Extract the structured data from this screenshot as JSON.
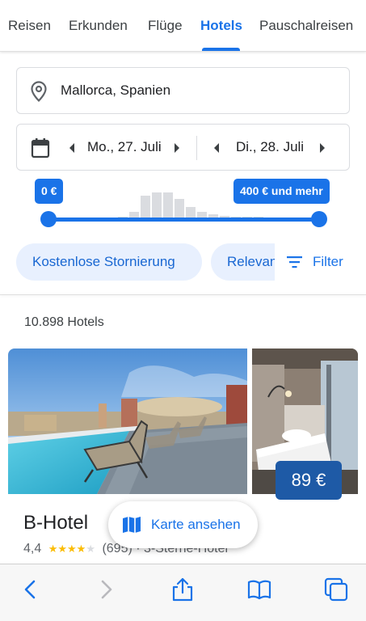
{
  "tabs": [
    {
      "label": "Reisen",
      "active": false
    },
    {
      "label": "Erkunden",
      "active": false
    },
    {
      "label": "Flüge",
      "active": false
    },
    {
      "label": "Hotels",
      "active": true
    },
    {
      "label": "Pauschalreisen",
      "active": false
    }
  ],
  "search": {
    "location_value": "Mallorca, Spanien",
    "location_icon": "location-pin-icon"
  },
  "dates": {
    "checkin": "Mo., 27. Juli",
    "checkout": "Di., 28. Juli",
    "calendar_icon": "calendar-icon"
  },
  "price_filter": {
    "min_label": "0 €",
    "max_label": "400 € und mehr"
  },
  "chips": {
    "free_cancellation": "Kostenlose Stornierung",
    "relevance": "Relevanz",
    "filter": "Filter"
  },
  "results": {
    "count_label": "10.898 Hotels"
  },
  "hotel": {
    "name": "B-Hotel",
    "price": "89 €",
    "rating": "4,4",
    "stars_out_of_5": 4.4,
    "reviews": "(695)",
    "separator": "·",
    "category": "3-Sterne-Hotel"
  },
  "map_button": {
    "label": "Karte ansehen",
    "icon": "map-icon"
  },
  "browser_bar": {
    "icons": [
      "back-icon",
      "forward-icon",
      "share-icon",
      "bookmarks-icon",
      "tabs-icon"
    ]
  },
  "colors": {
    "accent": "#1a73e8",
    "chip_bg": "#e8f0fe",
    "price_tag": "#1e5aa6",
    "star": "#fbbc04"
  }
}
